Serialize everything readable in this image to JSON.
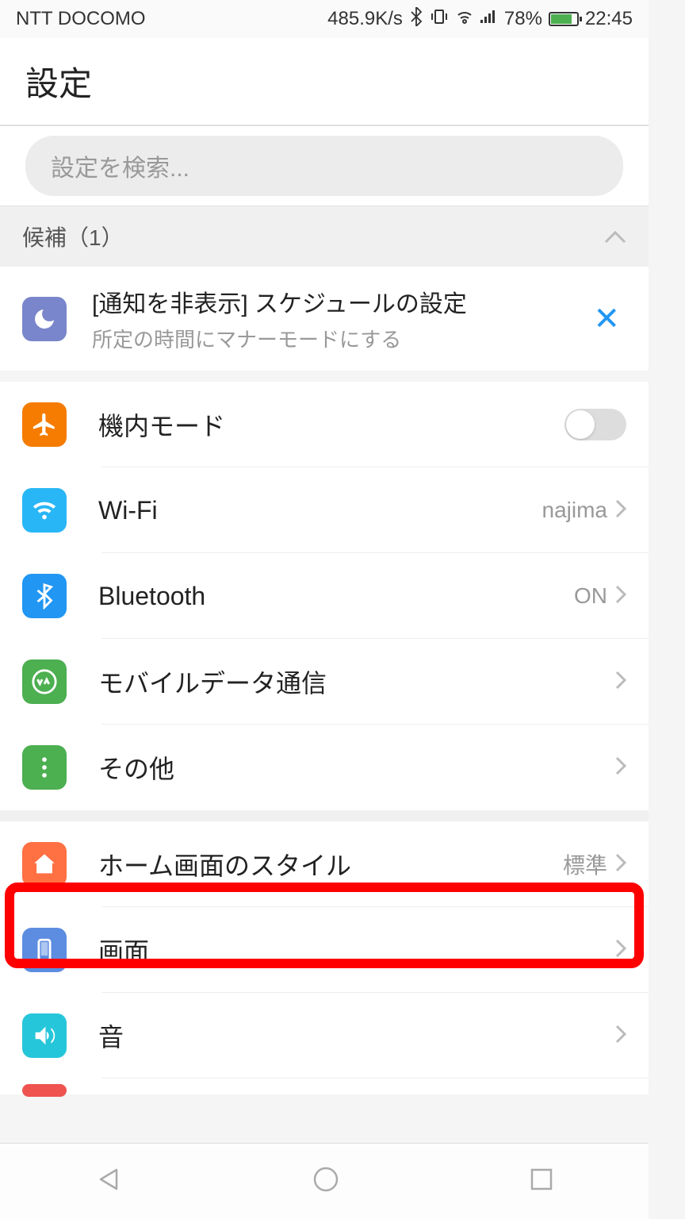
{
  "status": {
    "carrier": "NTT DOCOMO",
    "speed": "485.9K/s",
    "battery_pct": "78%",
    "time": "22:45"
  },
  "header": {
    "title": "設定"
  },
  "search": {
    "placeholder": "設定を検索..."
  },
  "suggestions": {
    "header": "候補（1）",
    "item": {
      "title": "[通知を非表示] スケジュールの設定",
      "subtitle": "所定の時間にマナーモードにする"
    }
  },
  "rows": {
    "airplane": {
      "label": "機内モード"
    },
    "wifi": {
      "label": "Wi-Fi",
      "value": "najima"
    },
    "bluetooth": {
      "label": "Bluetooth",
      "value": "ON"
    },
    "mobile_data": {
      "label": "モバイルデータ通信"
    },
    "other": {
      "label": "その他"
    },
    "home_style": {
      "label": "ホーム画面のスタイル",
      "value": "標準"
    },
    "display": {
      "label": "画面"
    },
    "sound": {
      "label": "音"
    }
  },
  "colors": {
    "airplane": "#f57c00",
    "wifi": "#29b6f6",
    "bluetooth": "#2196f3",
    "mobile": "#4caf50",
    "other": "#4caf50",
    "home": "#ff7043",
    "display": "#5c8de0",
    "sound": "#26c6da",
    "moon": "#7986cb"
  }
}
